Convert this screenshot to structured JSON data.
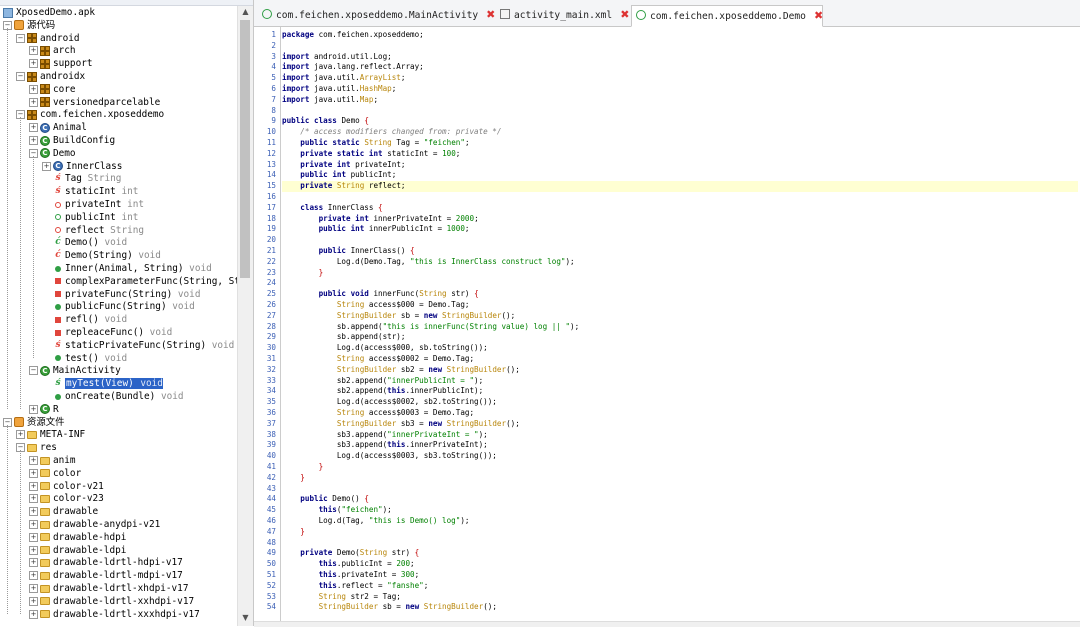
{
  "tree": [
    {
      "label": "XposedDemo.apk",
      "depth": 0,
      "icon": "apk-icon",
      "exp": ""
    },
    {
      "label": "源代码",
      "depth": 0,
      "icon": "source-root-icon",
      "exp": "-"
    },
    {
      "label": "android",
      "depth": 1,
      "icon": "package-icon",
      "exp": "-"
    },
    {
      "label": "arch",
      "depth": 2,
      "icon": "package-icon",
      "exp": "+"
    },
    {
      "label": "support",
      "depth": 2,
      "icon": "package-icon",
      "exp": "+"
    },
    {
      "label": "androidx",
      "depth": 1,
      "icon": "package-icon",
      "exp": "-"
    },
    {
      "label": "core",
      "depth": 2,
      "icon": "package-icon",
      "exp": "+"
    },
    {
      "label": "versionedparcelable",
      "depth": 2,
      "icon": "package-icon",
      "exp": "+"
    },
    {
      "label": "com.feichen.xposeddemo",
      "depth": 1,
      "icon": "package-icon",
      "exp": "-"
    },
    {
      "label": "Animal",
      "depth": 2,
      "icon": "class-blue-icon",
      "exp": "+"
    },
    {
      "label": "BuildConfig",
      "depth": 2,
      "icon": "class-icon",
      "exp": "+"
    },
    {
      "label": "Demo",
      "depth": 2,
      "icon": "class-icon",
      "exp": "-"
    },
    {
      "label": "InnerClass",
      "depth": 3,
      "icon": "class-blue-icon",
      "exp": "+"
    },
    {
      "label": "Tag",
      "type": "String",
      "depth": 3,
      "icon": "static-field-icon",
      "exp": ""
    },
    {
      "label": "staticInt",
      "type": "int",
      "depth": 3,
      "icon": "static-field-icon",
      "exp": ""
    },
    {
      "label": "privateInt",
      "type": "int",
      "depth": 3,
      "icon": "private-field-icon",
      "exp": ""
    },
    {
      "label": "publicInt",
      "type": "int",
      "depth": 3,
      "icon": "public-field-icon",
      "exp": ""
    },
    {
      "label": "reflect",
      "type": "String",
      "depth": 3,
      "icon": "private-field-icon",
      "exp": ""
    },
    {
      "label": "Demo()",
      "type": "void",
      "depth": 3,
      "icon": "constructor-icon",
      "exp": ""
    },
    {
      "label": "Demo(String)",
      "type": "void",
      "depth": 3,
      "icon": "private-constructor-icon",
      "exp": ""
    },
    {
      "label": "Inner(Animal, String)",
      "type": "void",
      "depth": 3,
      "icon": "public-method-icon",
      "exp": ""
    },
    {
      "label": "complexParameterFunc(String, Str",
      "type": "",
      "depth": 3,
      "icon": "private-method-icon",
      "exp": ""
    },
    {
      "label": "privateFunc(String)",
      "type": "void",
      "depth": 3,
      "icon": "private-method-icon",
      "exp": ""
    },
    {
      "label": "publicFunc(String)",
      "type": "void",
      "depth": 3,
      "icon": "public-method-icon",
      "exp": ""
    },
    {
      "label": "refl()",
      "type": "void",
      "depth": 3,
      "icon": "private-method-icon",
      "exp": ""
    },
    {
      "label": "repleaceFunc()",
      "type": "void",
      "depth": 3,
      "icon": "private-method-icon",
      "exp": ""
    },
    {
      "label": "staticPrivateFunc(String)",
      "type": "void",
      "depth": 3,
      "icon": "static-private-method-icon",
      "exp": ""
    },
    {
      "label": "test()",
      "type": "void",
      "depth": 3,
      "icon": "public-method-icon",
      "exp": ""
    },
    {
      "label": "MainActivity",
      "depth": 2,
      "icon": "class-icon",
      "exp": "-"
    },
    {
      "label": "myTest(View)",
      "type": "void",
      "depth": 3,
      "icon": "constructor-green-icon",
      "exp": "",
      "selected": true
    },
    {
      "label": "onCreate(Bundle)",
      "type": "void",
      "depth": 3,
      "icon": "public-method-icon",
      "exp": ""
    },
    {
      "label": "R",
      "depth": 2,
      "icon": "class-icon",
      "exp": "+"
    },
    {
      "label": "资源文件",
      "depth": 0,
      "icon": "resource-root-icon",
      "exp": "-"
    },
    {
      "label": "META-INF",
      "depth": 1,
      "icon": "folder-icon",
      "exp": "+"
    },
    {
      "label": "res",
      "depth": 1,
      "icon": "folder-icon",
      "exp": "-"
    },
    {
      "label": "anim",
      "depth": 2,
      "icon": "folder-icon",
      "exp": "+"
    },
    {
      "label": "color",
      "depth": 2,
      "icon": "folder-icon",
      "exp": "+"
    },
    {
      "label": "color-v21",
      "depth": 2,
      "icon": "folder-icon",
      "exp": "+"
    },
    {
      "label": "color-v23",
      "depth": 2,
      "icon": "folder-icon",
      "exp": "+"
    },
    {
      "label": "drawable",
      "depth": 2,
      "icon": "folder-icon",
      "exp": "+"
    },
    {
      "label": "drawable-anydpi-v21",
      "depth": 2,
      "icon": "folder-icon",
      "exp": "+"
    },
    {
      "label": "drawable-hdpi",
      "depth": 2,
      "icon": "folder-icon",
      "exp": "+"
    },
    {
      "label": "drawable-ldpi",
      "depth": 2,
      "icon": "folder-icon",
      "exp": "+"
    },
    {
      "label": "drawable-ldrtl-hdpi-v17",
      "depth": 2,
      "icon": "folder-icon",
      "exp": "+"
    },
    {
      "label": "drawable-ldrtl-mdpi-v17",
      "depth": 2,
      "icon": "folder-icon",
      "exp": "+"
    },
    {
      "label": "drawable-ldrtl-xhdpi-v17",
      "depth": 2,
      "icon": "folder-icon",
      "exp": "+"
    },
    {
      "label": "drawable-ldrtl-xxhdpi-v17",
      "depth": 2,
      "icon": "folder-icon",
      "exp": "+"
    },
    {
      "label": "drawable-ldrtl-xxxhdpi-v17",
      "depth": 2,
      "icon": "folder-icon",
      "exp": "+"
    }
  ],
  "tabs": [
    {
      "label": "com.feichen.xposeddemo.MainActivity",
      "icon": "class-icon",
      "active": false
    },
    {
      "label": "activity_main.xml",
      "icon": "xml-file-icon",
      "active": false
    },
    {
      "label": "com.feichen.xposeddemo.Demo",
      "icon": "class-icon",
      "active": true
    }
  ],
  "editor": {
    "highlight_line": 15,
    "lines": [
      "package com.feichen.xposeddemo;",
      "",
      "import android.util.Log;",
      "import java.lang.reflect.Array;",
      "import java.util.ArrayList;",
      "import java.util.HashMap;",
      "import java.util.Map;",
      "",
      "public class Demo {",
      "    /* access modifiers changed from: private */",
      "    public static String Tag = \"feichen\";",
      "    private static int staticInt = 100;",
      "    private int privateInt;",
      "    public int publicInt;",
      "    private String reflect;",
      "",
      "    class InnerClass {",
      "        private int innerPrivateInt = 2000;",
      "        public int innerPublicInt = 1000;",
      "",
      "        public InnerClass() {",
      "            Log.d(Demo.Tag, \"this is InnerClass construct log\");",
      "        }",
      "",
      "        public void innerFunc(String str) {",
      "            String access$000 = Demo.Tag;",
      "            StringBuilder sb = new StringBuilder();",
      "            sb.append(\"this is innerFunc(String value) log || \");",
      "            sb.append(str);",
      "            Log.d(access$000, sb.toString());",
      "            String access$0002 = Demo.Tag;",
      "            StringBuilder sb2 = new StringBuilder();",
      "            sb2.append(\"innerPublicInt = \");",
      "            sb2.append(this.innerPublicInt);",
      "            Log.d(access$0002, sb2.toString());",
      "            String access$0003 = Demo.Tag;",
      "            StringBuilder sb3 = new StringBuilder();",
      "            sb3.append(\"innerPrivateInt = \");",
      "            sb3.append(this.innerPrivateInt);",
      "            Log.d(access$0003, sb3.toString());",
      "        }",
      "    }",
      "",
      "    public Demo() {",
      "        this(\"feichen\");",
      "        Log.d(Tag, \"this is Demo() log\");",
      "    }",
      "",
      "    private Demo(String str) {",
      "        this.publicInt = 200;",
      "        this.privateInt = 300;",
      "        this.reflect = \"fanshe\";",
      "        String str2 = Tag;",
      "        StringBuilder sb = new StringBuilder();"
    ]
  },
  "colors": {
    "keyword": "#000080",
    "string": "#008000",
    "comment": "#808080",
    "class_ref": "#b8860b",
    "line_number": "#3b5fb5",
    "highlight": "#ffffd2",
    "selection": "#2b63c7"
  }
}
